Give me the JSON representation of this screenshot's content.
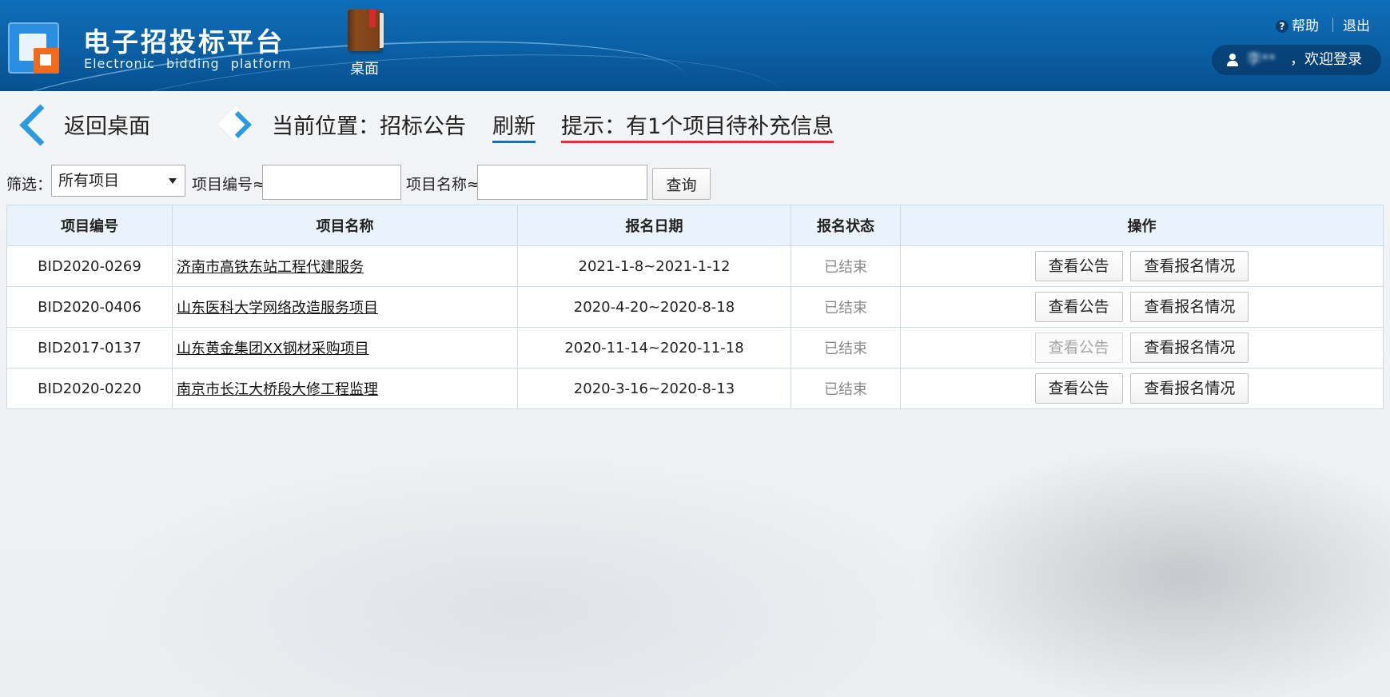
{
  "header": {
    "brand_cn": "电子招投标平台",
    "brand_en": "Electronic bidding platform",
    "desktop_label": "桌面",
    "help_label": "帮助",
    "logout_label": "退出",
    "user_name": "李**",
    "welcome_text": "，欢迎登录"
  },
  "breadcrumb": {
    "back_label": "返回桌面",
    "location_label": "当前位置：招标公告",
    "refresh_label": "刷新",
    "hint_label": "提示：有1个项目待补充信息"
  },
  "filter": {
    "filter_label": "筛选：",
    "selected_option": "所有项目",
    "code_label": "项目编号≈",
    "code_value": "",
    "name_label": "项目名称≈",
    "name_value": "",
    "query_label": "查询"
  },
  "table": {
    "columns": [
      "项目编号",
      "项目名称",
      "报名日期",
      "报名状态",
      "操作"
    ],
    "rows": [
      {
        "code": "BID2020-0269",
        "name": "济南市高铁东站工程代建服务",
        "date": "2021-1-8~2021-1-12",
        "status": "已结束",
        "btn1": "查看公告",
        "btn2": "查看报名情况"
      },
      {
        "code": "BID2020-0406",
        "name": "山东医科大学网络改造服务项目",
        "date": "2020-4-20~2020-8-18",
        "status": "已结束",
        "btn1": "查看公告",
        "btn2": "查看报名情况"
      },
      {
        "code": "BID2017-0137",
        "name": "山东黄金集团XX钢材采购项目",
        "date": "2020-11-14~2020-11-18",
        "status": "已结束",
        "btn1": "查看公告",
        "btn2": "查看报名情况"
      },
      {
        "code": "BID2020-0220",
        "name": "南京市长江大桥段大修工程监理",
        "date": "2020-3-16~2020-8-13",
        "status": "已结束",
        "btn1": "查看公告",
        "btn2": "查看报名情况"
      }
    ]
  },
  "colors": {
    "header_blue": "#0b5fa4",
    "accent_blue": "#2b9be0",
    "refresh_underline": "#1f6db8",
    "hint_underline": "#d8323a",
    "logo_orange": "#f26b1d"
  },
  "icons": {
    "logo": "platform-logo-icon",
    "desktop": "book-icon",
    "help": "question-circle-icon",
    "user": "user-icon",
    "back": "chevron-left-icon",
    "location": "diamond-chevron-right-icon",
    "select": "caret-down-icon"
  }
}
